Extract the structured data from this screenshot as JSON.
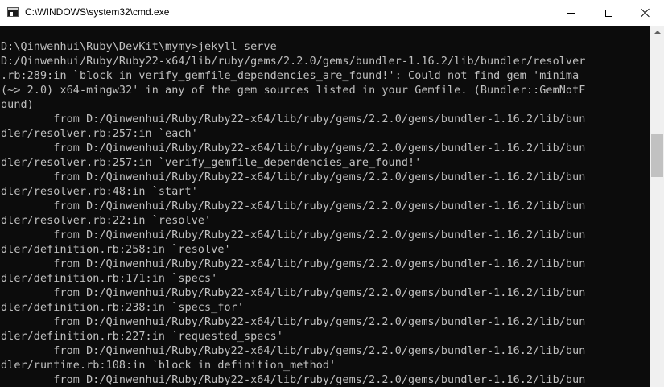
{
  "window": {
    "title": "C:\\WINDOWS\\system32\\cmd.exe",
    "icon": "cmd-console-icon",
    "controls": [
      "minimize-icon",
      "maximize-icon",
      "close-icon"
    ]
  },
  "console": {
    "background": "#0c0c0c",
    "foreground": "#c0c0c0",
    "lines": [
      "",
      "D:\\Qinwenhui\\Ruby\\DevKit\\mymy>jekyll serve",
      "D:/Qinwenhui/Ruby/Ruby22-x64/lib/ruby/gems/2.2.0/gems/bundler-1.16.2/lib/bundler/resolver",
      ".rb:289:in `block in verify_gemfile_dependencies_are_found!': Could not find gem 'minima",
      "(~> 2.0) x64-mingw32' in any of the gem sources listed in your Gemfile. (Bundler::GemNotF",
      "ound)",
      "        from D:/Qinwenhui/Ruby/Ruby22-x64/lib/ruby/gems/2.2.0/gems/bundler-1.16.2/lib/bun",
      "dler/resolver.rb:257:in `each'",
      "        from D:/Qinwenhui/Ruby/Ruby22-x64/lib/ruby/gems/2.2.0/gems/bundler-1.16.2/lib/bun",
      "dler/resolver.rb:257:in `verify_gemfile_dependencies_are_found!'",
      "        from D:/Qinwenhui/Ruby/Ruby22-x64/lib/ruby/gems/2.2.0/gems/bundler-1.16.2/lib/bun",
      "dler/resolver.rb:48:in `start'",
      "        from D:/Qinwenhui/Ruby/Ruby22-x64/lib/ruby/gems/2.2.0/gems/bundler-1.16.2/lib/bun",
      "dler/resolver.rb:22:in `resolve'",
      "        from D:/Qinwenhui/Ruby/Ruby22-x64/lib/ruby/gems/2.2.0/gems/bundler-1.16.2/lib/bun",
      "dler/definition.rb:258:in `resolve'",
      "        from D:/Qinwenhui/Ruby/Ruby22-x64/lib/ruby/gems/2.2.0/gems/bundler-1.16.2/lib/bun",
      "dler/definition.rb:171:in `specs'",
      "        from D:/Qinwenhui/Ruby/Ruby22-x64/lib/ruby/gems/2.2.0/gems/bundler-1.16.2/lib/bun",
      "dler/definition.rb:238:in `specs_for'",
      "        from D:/Qinwenhui/Ruby/Ruby22-x64/lib/ruby/gems/2.2.0/gems/bundler-1.16.2/lib/bun",
      "dler/definition.rb:227:in `requested_specs'",
      "        from D:/Qinwenhui/Ruby/Ruby22-x64/lib/ruby/gems/2.2.0/gems/bundler-1.16.2/lib/bun",
      "dler/runtime.rb:108:in `block in definition_method'",
      "        from D:/Qinwenhui/Ruby/Ruby22-x64/lib/ruby/gems/2.2.0/gems/bundler-1.16.2/lib/bun"
    ]
  }
}
